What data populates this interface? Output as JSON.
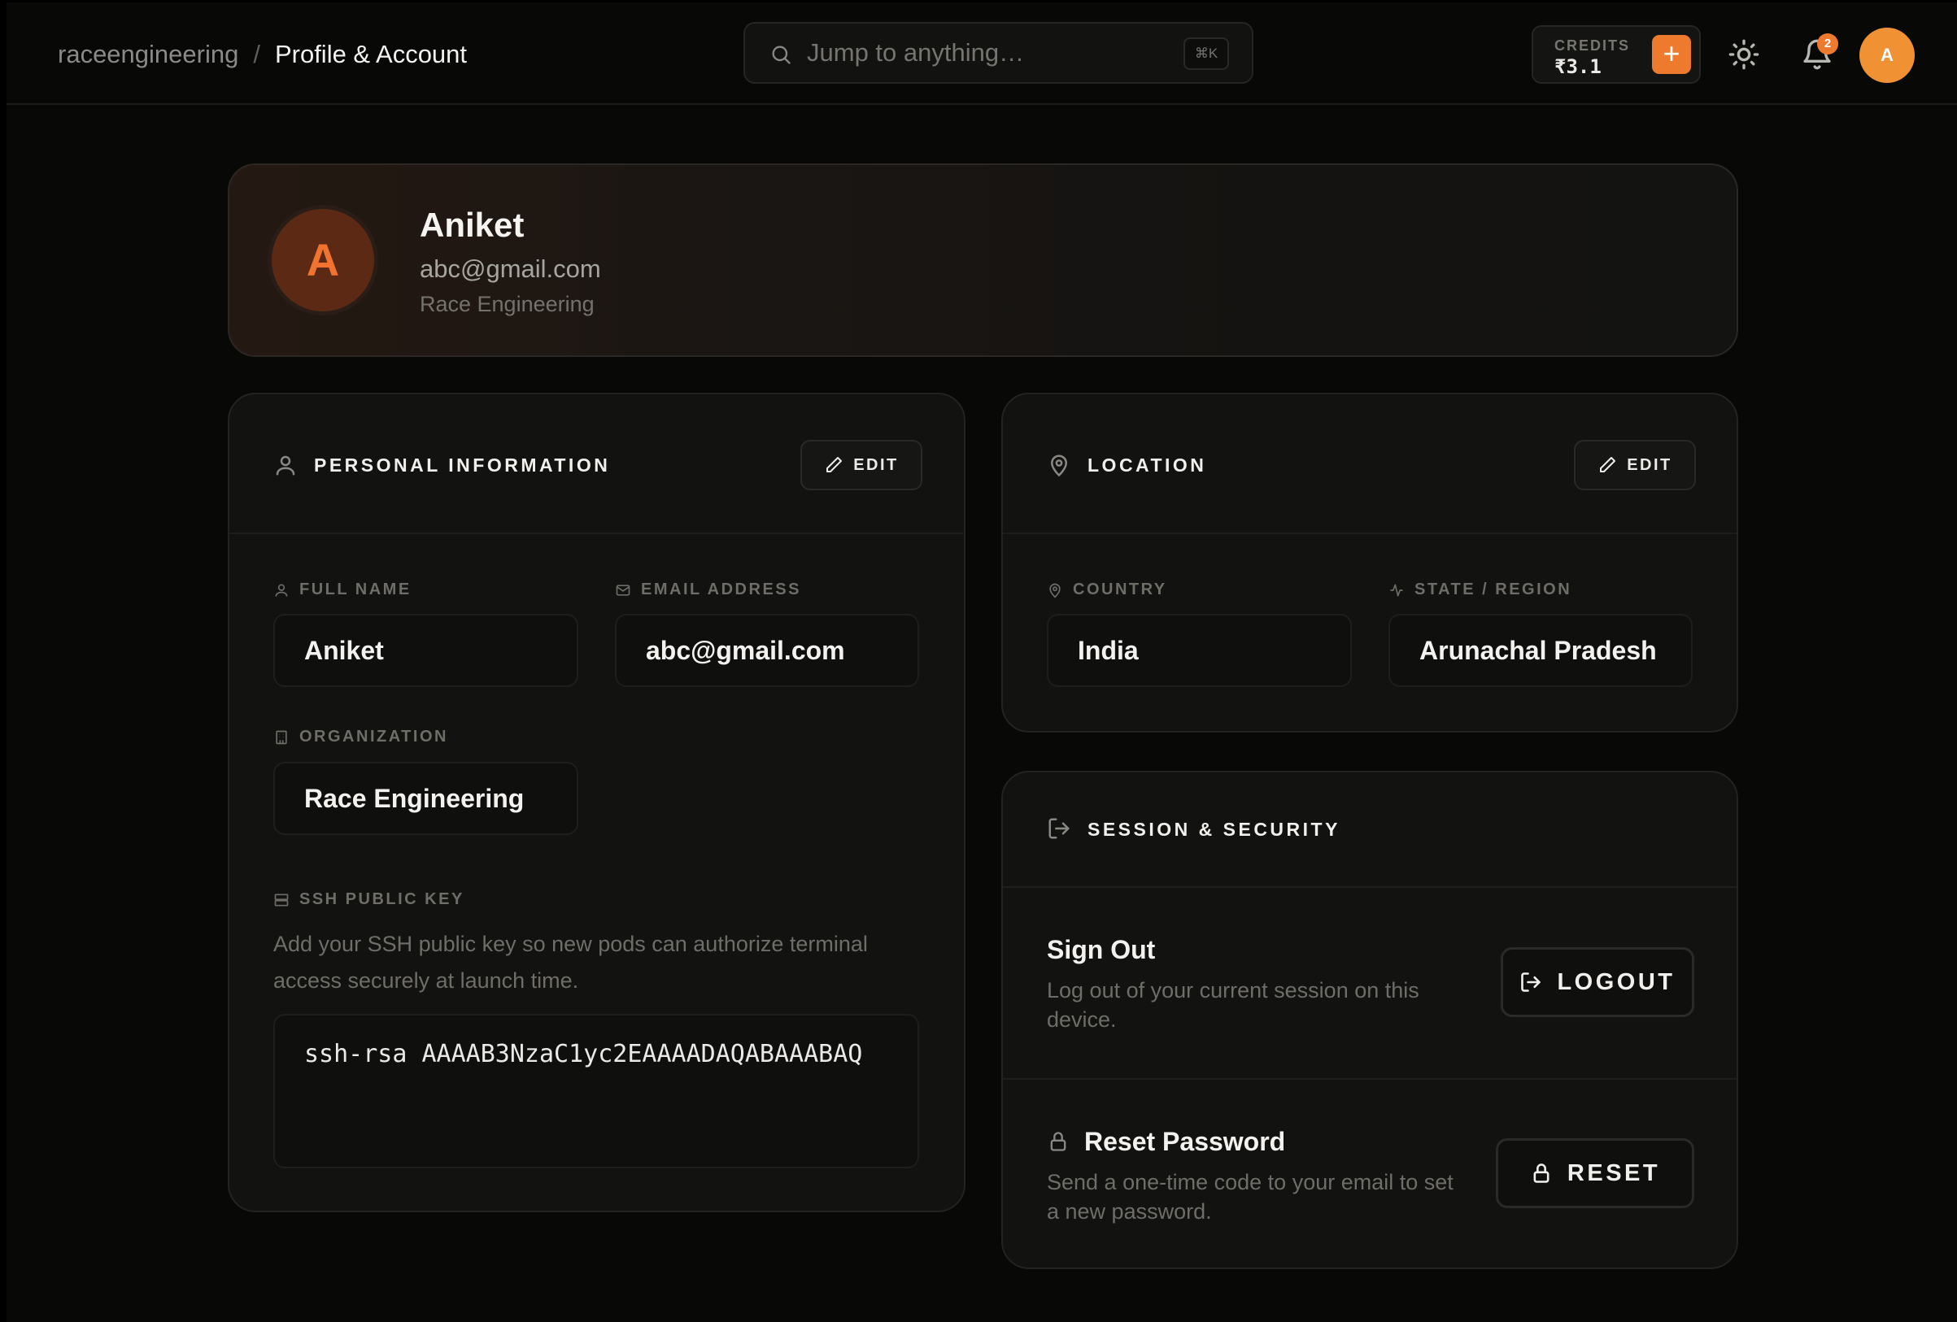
{
  "breadcrumb": {
    "root": "raceengineering",
    "separator": "/",
    "current": "Profile & Account"
  },
  "search": {
    "placeholder": "Jump to anything…",
    "shortcut": "⌘K"
  },
  "credits": {
    "label": "CREDITS",
    "value": "₹3.1",
    "add_label": "+"
  },
  "notifications": {
    "count": "2"
  },
  "user_avatar": {
    "initial": "A"
  },
  "profile": {
    "initial": "A",
    "name": "Aniket",
    "email": "abc@gmail.com",
    "organization": "Race Engineering"
  },
  "personal_info": {
    "title": "PERSONAL INFORMATION",
    "edit_label": "EDIT",
    "full_name_label": "FULL NAME",
    "full_name": "Aniket",
    "email_label": "EMAIL ADDRESS",
    "email": "abc@gmail.com",
    "organization_label": "ORGANIZATION",
    "organization": "Race Engineering",
    "ssh_label": "SSH PUBLIC KEY",
    "ssh_description": "Add your SSH public key so new pods can authorize terminal access securely at launch time.",
    "ssh_value": "ssh-rsa AAAAB3NzaC1yc2EAAAADAQABAAABAQ"
  },
  "location": {
    "title": "LOCATION",
    "edit_label": "EDIT",
    "country_label": "COUNTRY",
    "country": "India",
    "state_label": "STATE / REGION",
    "state": "Arunachal Pradesh"
  },
  "session": {
    "title": "SESSION & SECURITY",
    "signout_title": "Sign Out",
    "signout_desc": "Log out of your current session on this device.",
    "logout_label": "LOGOUT",
    "reset_title": "Reset Password",
    "reset_desc": "Send a one-time code to your email to set a new password.",
    "reset_label": "RESET"
  },
  "colors": {
    "accent": "#ee7a2e",
    "background": "#080807",
    "card": "#121210"
  }
}
